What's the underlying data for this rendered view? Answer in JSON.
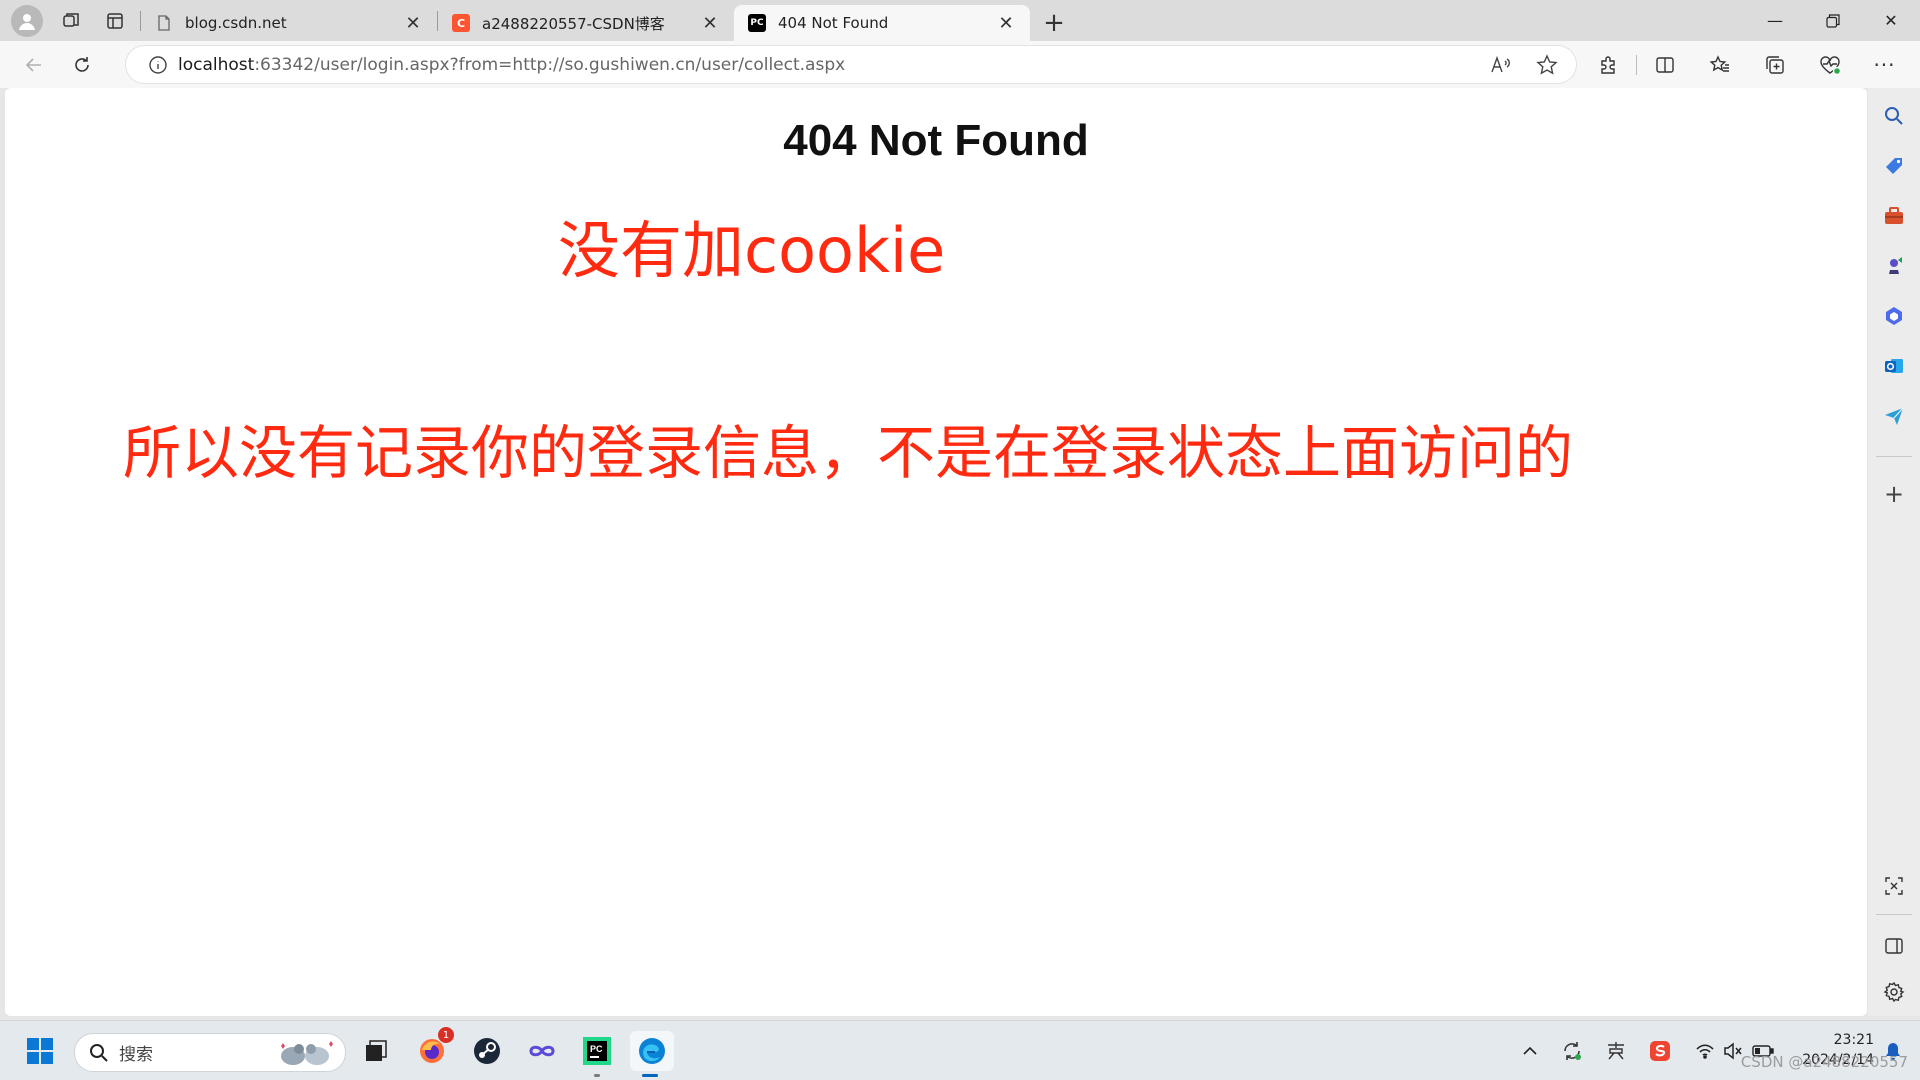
{
  "browser": {
    "tabs": [
      {
        "title": "blog.csdn.net",
        "favicon": "page-icon",
        "active": false
      },
      {
        "title": "a2488220557-CSDN博客",
        "favicon": "csdn-icon",
        "active": false
      },
      {
        "title": "404 Not Found",
        "favicon": "pycharm-icon",
        "active": true
      }
    ],
    "address": {
      "host": "localhost",
      "rest": ":63342/user/login.aspx?from=http://so.gushiwen.cn/user/collect.aspx"
    }
  },
  "page": {
    "heading": "404 Not Found",
    "note_1": "没有加cookie",
    "note_2": "所以没有记录你的登录信息，不是在登录状态上面访问的",
    "note_color": "#ff2a10"
  },
  "taskbar": {
    "search_placeholder": "搜索",
    "firefox_badge": "1",
    "time": "23:21",
    "date": "2024/2/14",
    "watermark": "CSDN @a2488220557"
  }
}
